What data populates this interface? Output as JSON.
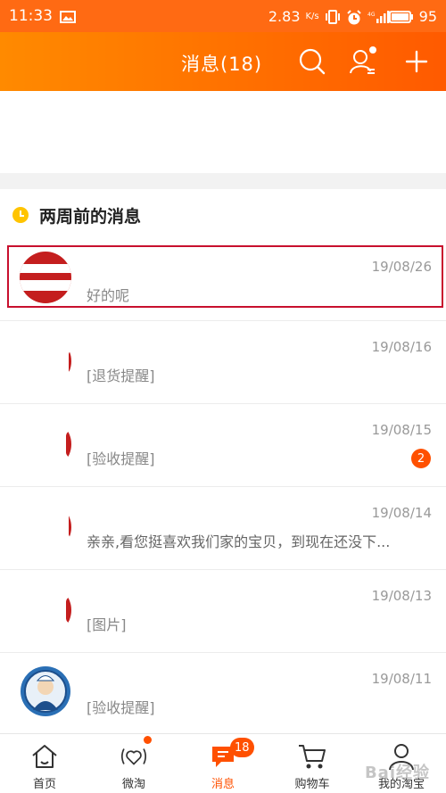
{
  "status_bar": {
    "time": "11:33",
    "network_speed": "2.83",
    "network_unit": "K/s",
    "battery": "95"
  },
  "header": {
    "title": "消息(18)"
  },
  "section": {
    "title": "两周前的消息"
  },
  "messages": [
    {
      "date": "19/08/26",
      "text": "好的呢",
      "badge": ""
    },
    {
      "date": "19/08/16",
      "text": "[退货提醒]",
      "badge": ""
    },
    {
      "date": "19/08/15",
      "text": "[验收提醒]",
      "badge": "2"
    },
    {
      "date": "19/08/14",
      "text": "亲亲,看您挺喜欢我们家的宝贝，到现在还没下...",
      "badge": ""
    },
    {
      "date": "19/08/13",
      "text": "[图片]",
      "badge": ""
    },
    {
      "date": "19/08/11",
      "text": "[验收提醒]",
      "badge": ""
    }
  ],
  "tabbar": {
    "home": "首页",
    "weitao": "微淘",
    "messages": "消息",
    "messages_badge": "18",
    "cart": "购物车",
    "mine": "我的淘宝"
  },
  "watermark": "Bai经验",
  "colors": {
    "accent": "#ff5000",
    "header_start": "#ff8a00",
    "header_end": "#ff5a00",
    "highlight": "#c8102e"
  }
}
